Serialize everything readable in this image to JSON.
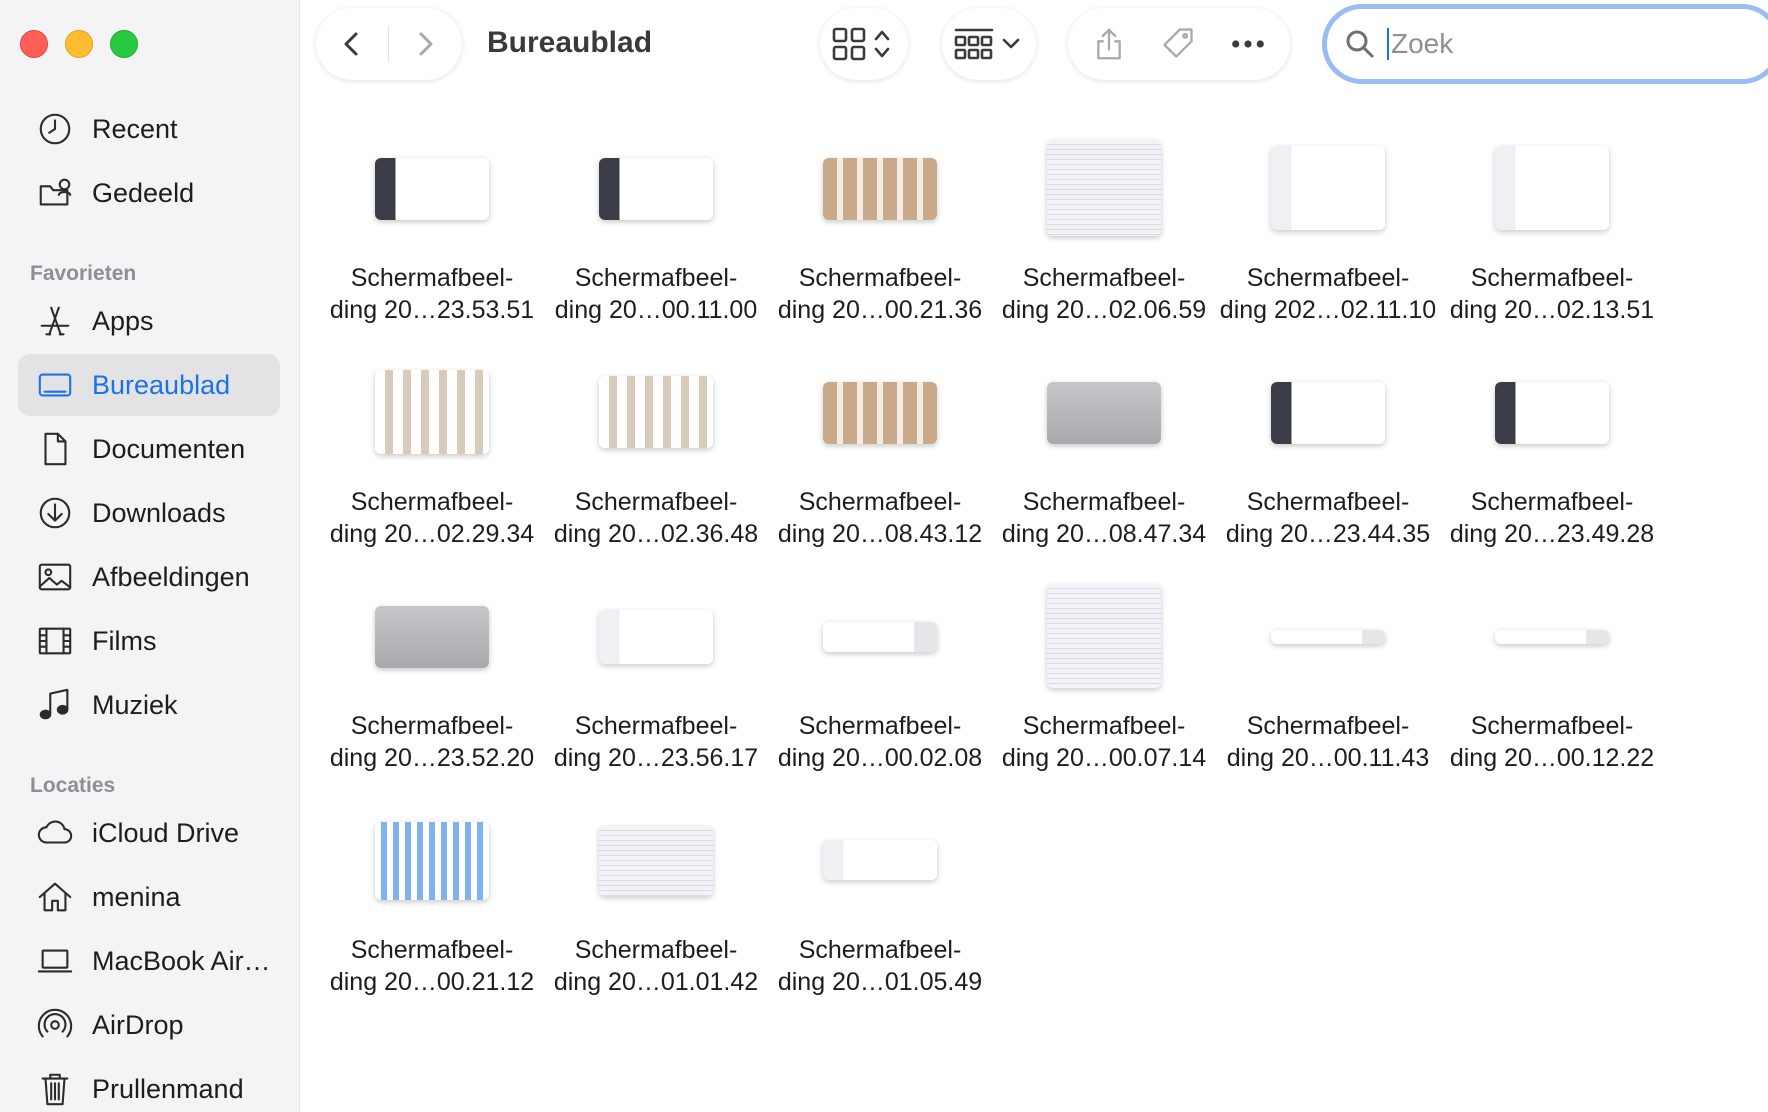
{
  "window": {
    "title": "Bureaublad"
  },
  "sidebar": {
    "top_items": [
      {
        "label": "Recent",
        "icon": "clock-icon"
      },
      {
        "label": "Gedeeld",
        "icon": "shared-folder-icon"
      }
    ],
    "favorites_label": "Favorieten",
    "favorites": [
      {
        "label": "Apps",
        "icon": "apps-icon"
      },
      {
        "label": "Bureaublad",
        "icon": "desktop-icon",
        "active": true
      },
      {
        "label": "Documenten",
        "icon": "document-icon"
      },
      {
        "label": "Downloads",
        "icon": "download-icon"
      },
      {
        "label": "Afbeeldingen",
        "icon": "photo-icon"
      },
      {
        "label": "Films",
        "icon": "film-icon"
      },
      {
        "label": "Muziek",
        "icon": "music-icon"
      }
    ],
    "locations_label": "Locaties",
    "locations": [
      {
        "label": "iCloud Drive",
        "icon": "cloud-icon"
      },
      {
        "label": "menina",
        "icon": "home-icon"
      },
      {
        "label": "MacBook Air…",
        "icon": "laptop-icon"
      },
      {
        "label": "AirDrop",
        "icon": "airdrop-icon"
      },
      {
        "label": "Prullenmand",
        "icon": "trash-icon"
      }
    ]
  },
  "search": {
    "placeholder": "Zoek",
    "value": ""
  },
  "colors": {
    "accent": "#1a73e8",
    "sidebar_bg": "#f4f4f6",
    "active_bg": "#e3e3e6",
    "search_ring": "#9bbcf0"
  },
  "files": [
    {
      "line1": "Schermafbeel-",
      "line2": "ding 20…23.53.51"
    },
    {
      "line1": "Schermafbeel-",
      "line2": "ding 20…00.11.00"
    },
    {
      "line1": "Schermafbeel-",
      "line2": "ding 20…00.21.36"
    },
    {
      "line1": "Schermafbeel-",
      "line2": "ding 20…02.06.59"
    },
    {
      "line1": "Schermafbeel-",
      "line2": "ding 202…02.11.10"
    },
    {
      "line1": "Schermafbeel-",
      "line2": "ding 20…02.13.51"
    },
    {
      "line1": "Schermafbeel-",
      "line2": "ding 20…02.29.34"
    },
    {
      "line1": "Schermafbeel-",
      "line2": "ding 20…02.36.48"
    },
    {
      "line1": "Schermafbeel-",
      "line2": "ding 20…08.43.12"
    },
    {
      "line1": "Schermafbeel-",
      "line2": "ding 20…08.47.34"
    },
    {
      "line1": "Schermafbeel-",
      "line2": "ding 20…23.44.35"
    },
    {
      "line1": "Schermafbeel-",
      "line2": "ding 20…23.49.28"
    },
    {
      "line1": "Schermafbeel-",
      "line2": "ding 20…23.52.20"
    },
    {
      "line1": "Schermafbeel-",
      "line2": "ding 20…23.56.17"
    },
    {
      "line1": "Schermafbeel-",
      "line2": "ding 20…00.02.08"
    },
    {
      "line1": "Schermafbeel-",
      "line2": "ding 20…00.07.14"
    },
    {
      "line1": "Schermafbeel-",
      "line2": "ding 20…00.11.43"
    },
    {
      "line1": "Schermafbeel-",
      "line2": "ding 20…00.12.22"
    },
    {
      "line1": "Schermafbeel-",
      "line2": "ding 20…00.21.12"
    },
    {
      "line1": "Schermafbeel-",
      "line2": "ding 20…01.01.42"
    },
    {
      "line1": "Schermafbeel-",
      "line2": "ding 20…01.05.49"
    }
  ]
}
